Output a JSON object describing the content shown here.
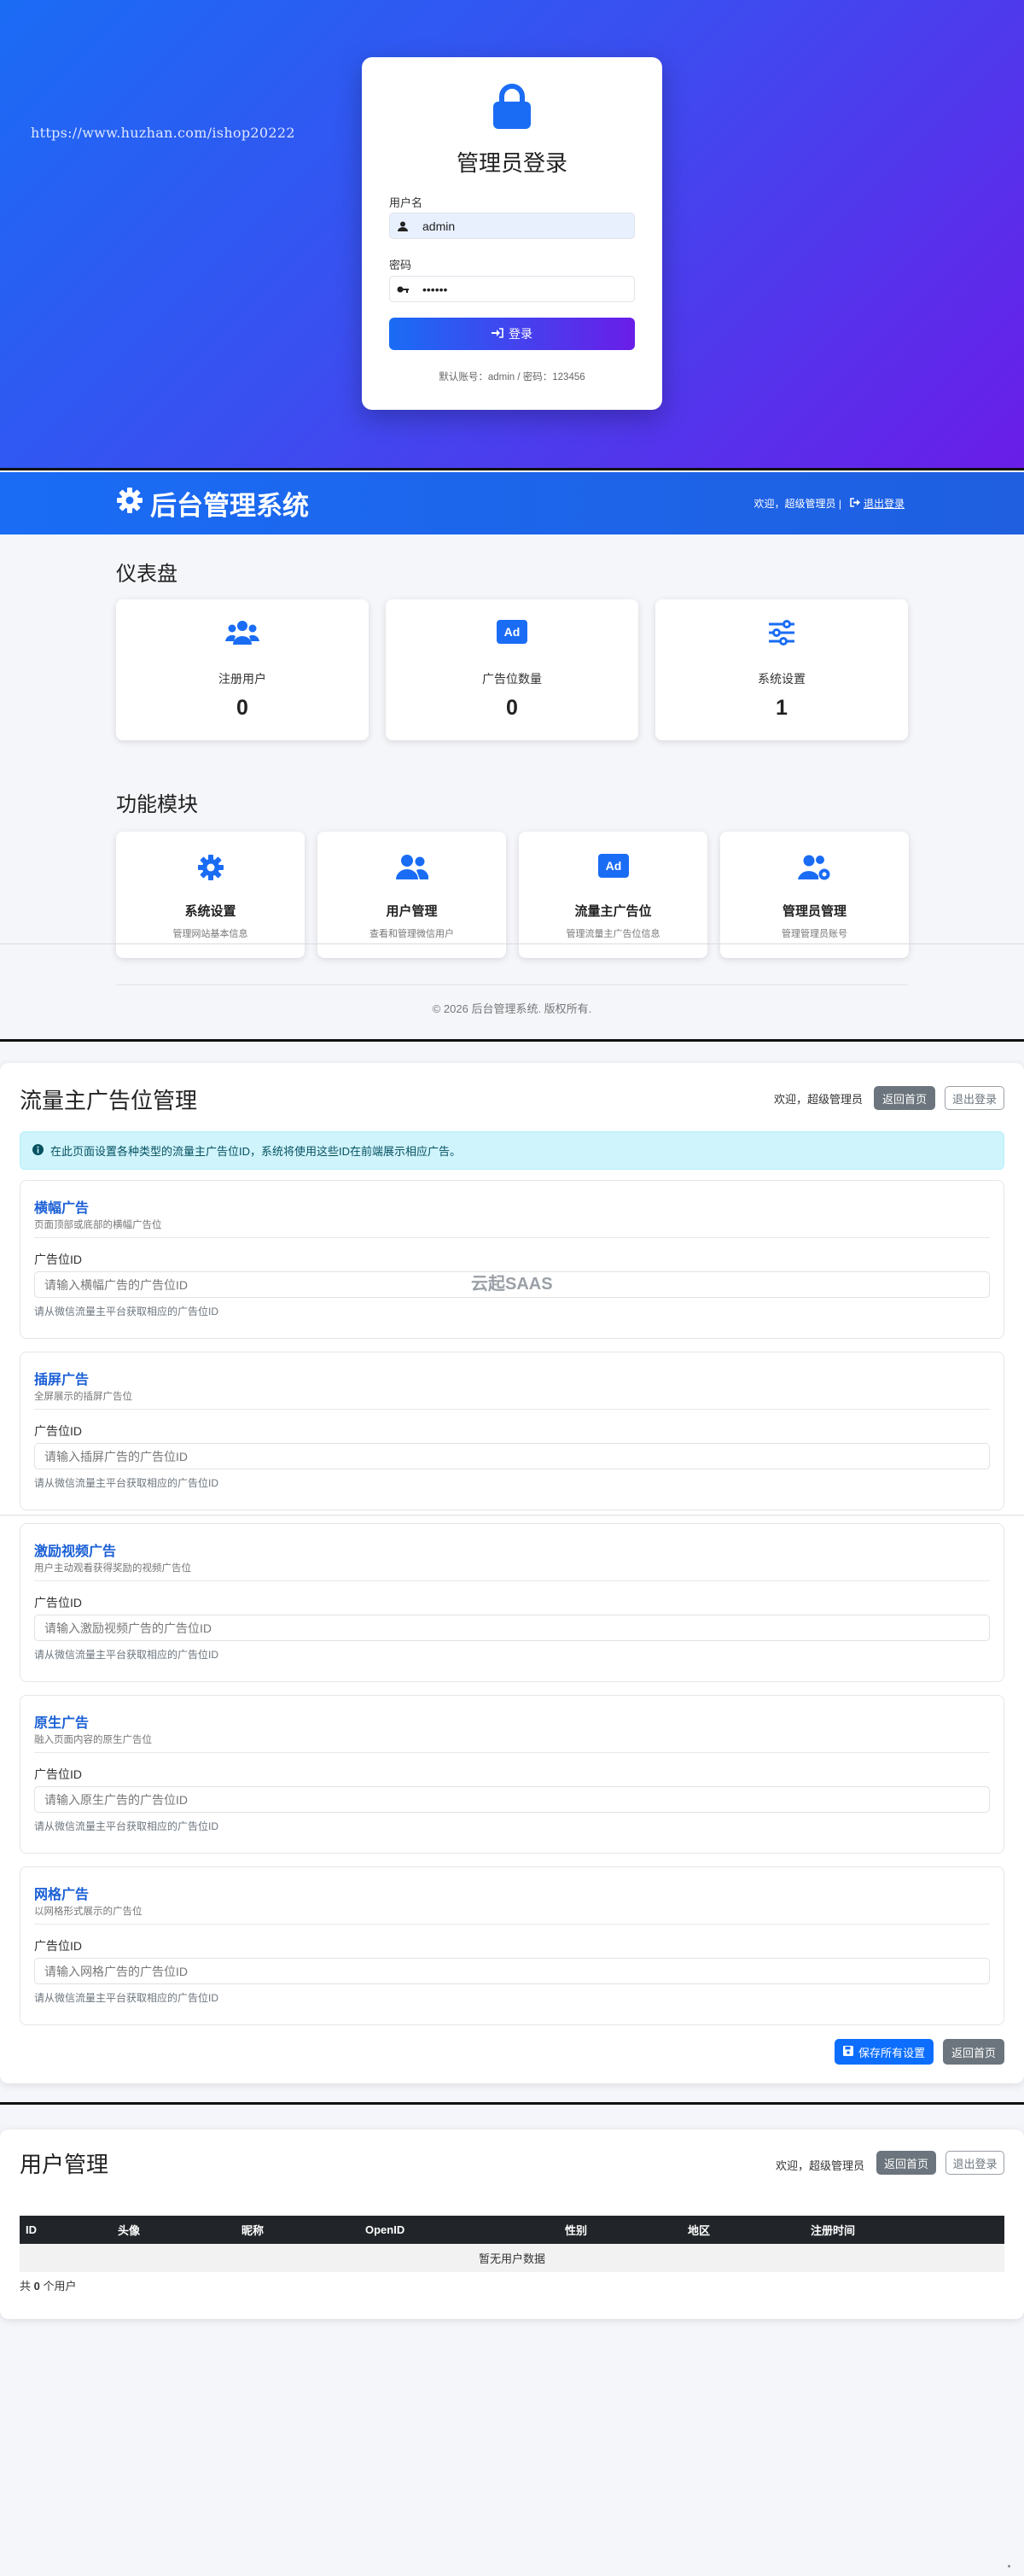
{
  "login": {
    "watermark": "https://www.huzhan.com/ishop20222",
    "title": "管理员登录",
    "username_label": "用户名",
    "username_value": "admin",
    "password_label": "密码",
    "password_value": "••••••",
    "login_button": "登录",
    "hint": "默认账号：admin / 密码：123456"
  },
  "dashboard": {
    "brand": "后台管理系统",
    "welcome": "欢迎，超级管理员 |",
    "logout": "退出登录",
    "overview_title": "仪表盘",
    "stats": [
      {
        "label": "注册用户",
        "value": "0",
        "icon": "users-icon"
      },
      {
        "label": "广告位数量",
        "value": "0",
        "icon": "ad-icon"
      },
      {
        "label": "系统设置",
        "value": "1",
        "icon": "sliders-icon"
      }
    ],
    "modules_title": "功能模块",
    "modules": [
      {
        "label": "系统设置",
        "desc": "管理网站基本信息",
        "icon": "gear-icon"
      },
      {
        "label": "用户管理",
        "desc": "查看和管理微信用户",
        "icon": "users-icon"
      },
      {
        "label": "流量主广告位",
        "desc": "管理流量主广告位信息",
        "icon": "ad-icon"
      },
      {
        "label": "管理员管理",
        "desc": "管理管理员账号",
        "icon": "users-gear-icon"
      }
    ],
    "footer": "© 2026 后台管理系统. 版权所有."
  },
  "ads": {
    "title": "流量主广告位管理",
    "welcome": "欢迎，超级管理员",
    "home_button": "返回首页",
    "logout_button": "退出登录",
    "info": "在此页面设置各种类型的流量主广告位ID，系统将使用这些ID在前端展示相应广告。",
    "field_label": "广告位ID",
    "hint": "请从微信流量主平台获取相应的广告位ID",
    "watermark": "云起SAAS",
    "cards": [
      {
        "title": "横幅广告",
        "sub": "页面顶部或底部的横幅广告位",
        "placeholder": "请输入横幅广告的广告位ID"
      },
      {
        "title": "插屏广告",
        "sub": "全屏展示的插屏广告位",
        "placeholder": "请输入插屏广告的广告位ID"
      },
      {
        "title": "激励视频广告",
        "sub": "用户主动观看获得奖励的视频广告位",
        "placeholder": "请输入激励视频广告的广告位ID"
      },
      {
        "title": "原生广告",
        "sub": "融入页面内容的原生广告位",
        "placeholder": "请输入原生广告的广告位ID"
      },
      {
        "title": "网格广告",
        "sub": "以网格形式展示的广告位",
        "placeholder": "请输入网格广告的广告位ID"
      }
    ],
    "save_button": "保存所有设置",
    "back_button": "返回首页"
  },
  "users": {
    "title": "用户管理",
    "welcome": "欢迎，超级管理员",
    "home_button": "返回首页",
    "logout_button": "退出登录",
    "columns": [
      "ID",
      "头像",
      "昵称",
      "OpenID",
      "性别",
      "地区",
      "注册时间"
    ],
    "empty": "暂无用户数据",
    "count_prefix": "共",
    "count": "0",
    "count_suffix": "个用户"
  },
  "colors": {
    "primary": "#1a6cf5",
    "gradient_end": "#6a1de8",
    "link": "#1a5fd6",
    "info_bg": "#cff4fc",
    "table_header": "#212529"
  }
}
